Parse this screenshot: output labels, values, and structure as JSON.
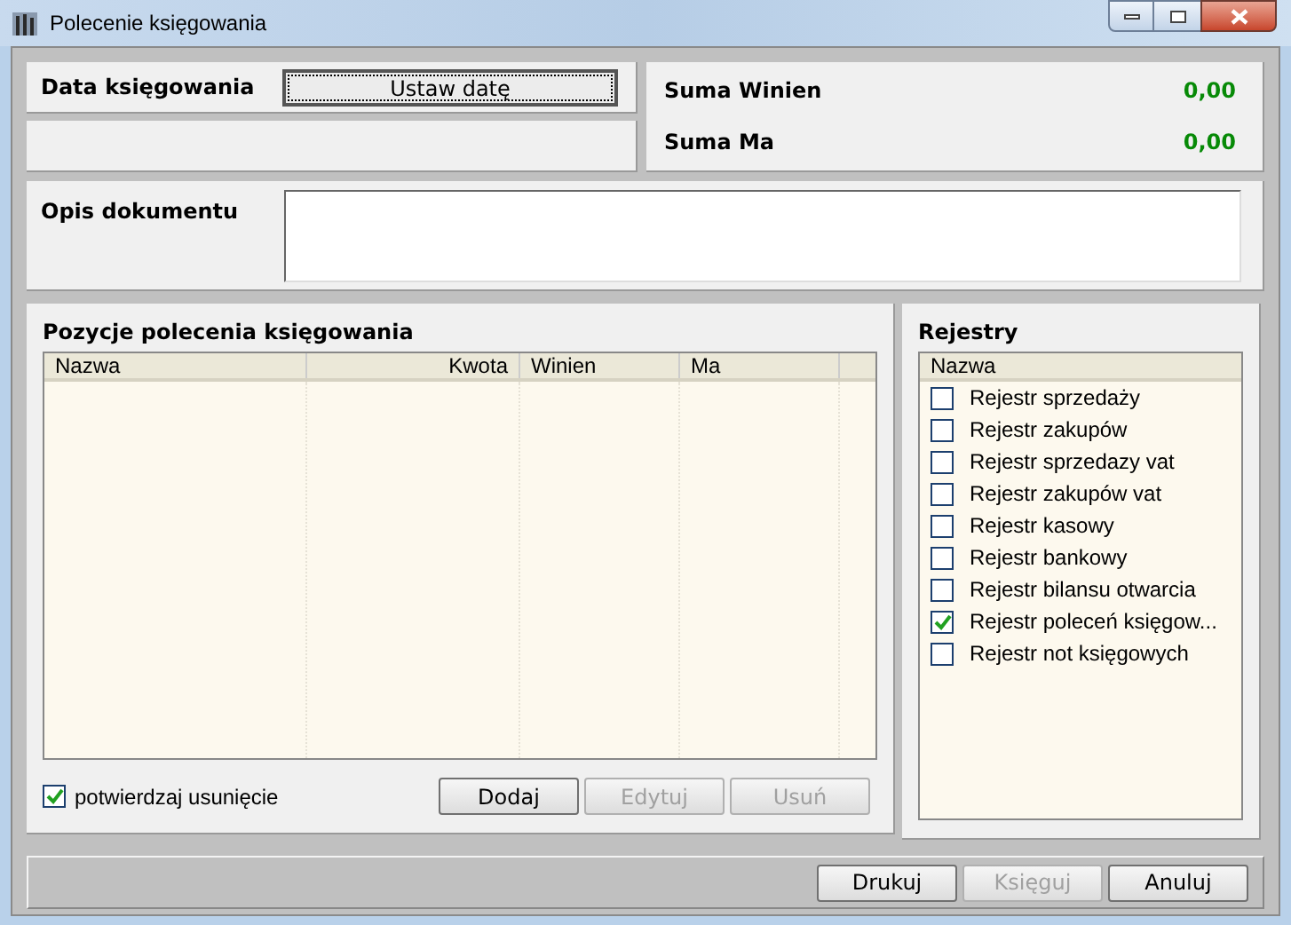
{
  "window": {
    "title": "Polecenie księgowania"
  },
  "date": {
    "label": "Data księgowania",
    "button": "Ustaw datę"
  },
  "sums": [
    {
      "label": "Suma Winien",
      "value": "0,00"
    },
    {
      "label": "Suma Ma",
      "value": "0,00"
    }
  ],
  "description": {
    "label": "Opis dokumentu"
  },
  "positions": {
    "title": "Pozycje polecenia księgowania",
    "columns": [
      "Nazwa",
      "Kwota",
      "Winien",
      "Ma"
    ],
    "confirm": {
      "label": "potwierdzaj usunięcie",
      "checked": true
    },
    "buttons": [
      {
        "label": "Dodaj",
        "disabled": false
      },
      {
        "label": "Edytuj",
        "disabled": true
      },
      {
        "label": "Usuń",
        "disabled": true
      }
    ]
  },
  "registers": {
    "title": "Rejestry",
    "column": "Nazwa",
    "items": [
      {
        "label": "Rejestr sprzedaży",
        "checked": false
      },
      {
        "label": "Rejestr zakupów",
        "checked": false
      },
      {
        "label": "Rejestr sprzedazy vat",
        "checked": false
      },
      {
        "label": "Rejestr zakupów vat",
        "checked": false
      },
      {
        "label": "Rejestr kasowy",
        "checked": false
      },
      {
        "label": "Rejestr bankowy",
        "checked": false
      },
      {
        "label": "Rejestr bilansu otwarcia",
        "checked": false
      },
      {
        "label": "Rejestr poleceń księgow...",
        "checked": true
      },
      {
        "label": "Rejestr not księgowych",
        "checked": false
      }
    ]
  },
  "footer_buttons": [
    {
      "label": "Drukuj",
      "disabled": false
    },
    {
      "label": "Księguj",
      "disabled": true
    },
    {
      "label": "Anuluj",
      "disabled": false
    }
  ]
}
